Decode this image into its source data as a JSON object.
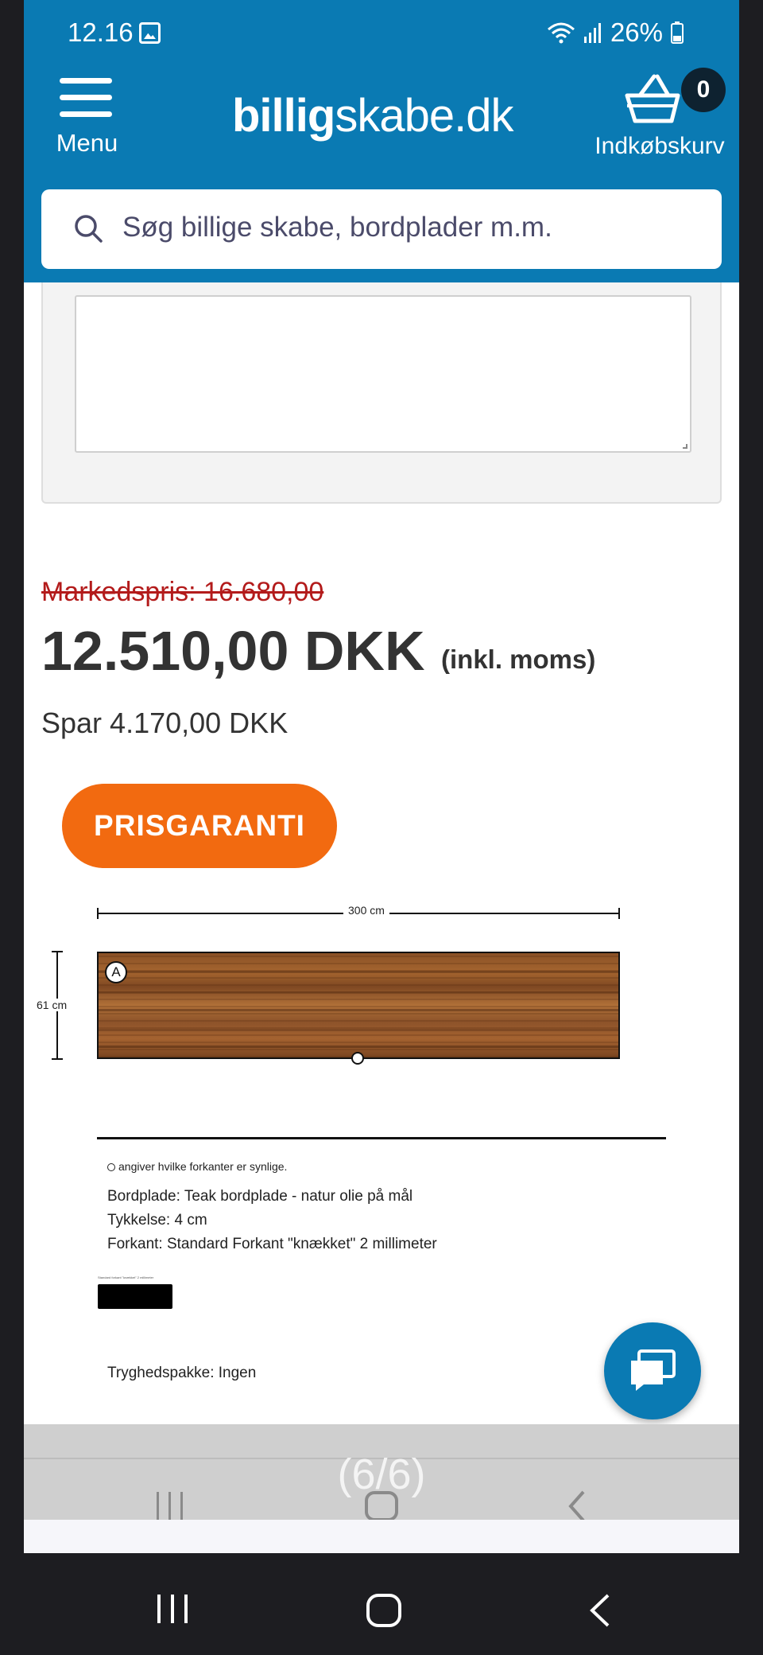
{
  "status_bar": {
    "time": "12.16",
    "battery": "26%",
    "icons": [
      "gallery-icon",
      "wifi-icon",
      "signal-icon",
      "battery-icon"
    ]
  },
  "header": {
    "menu_label": "Menu",
    "logo_bold": "billig",
    "logo_rest": "skabe.dk",
    "cart_count": "0",
    "cart_label": "Indkøbskurv",
    "background": "#0a7ab3"
  },
  "search": {
    "placeholder": "Søg billige skabe, bordplader m.m."
  },
  "pricing": {
    "market_price": "Markedspris: 16.680,00",
    "price": "12.510,00 DKK",
    "price_note": "(inkl. moms)",
    "savings": "Spar 4.170,00 DKK",
    "guarantee_button": "PRISGARANTI",
    "guarantee_color": "#f26a10"
  },
  "drawing": {
    "width_label": "300 cm",
    "height_label": "61 cm",
    "corner_marker": "A",
    "legend": "angiver hvilke forkanter er synlige.",
    "spec_lines": [
      "Bordplade: Teak bordplade - natur olie på mål",
      "Tykkelse: 4 cm",
      "Forkant: Standard Forkant \"knækket\" 2 millimeter"
    ],
    "tiny_text": "Standard forkant \"knækket\" 2 millimeter",
    "safety_package": "Tryghedspakke: Ingen"
  },
  "overlay": {
    "slide_counter": "(6/6)"
  },
  "navigation": {
    "keys": [
      "recent-apps",
      "home",
      "back"
    ]
  }
}
